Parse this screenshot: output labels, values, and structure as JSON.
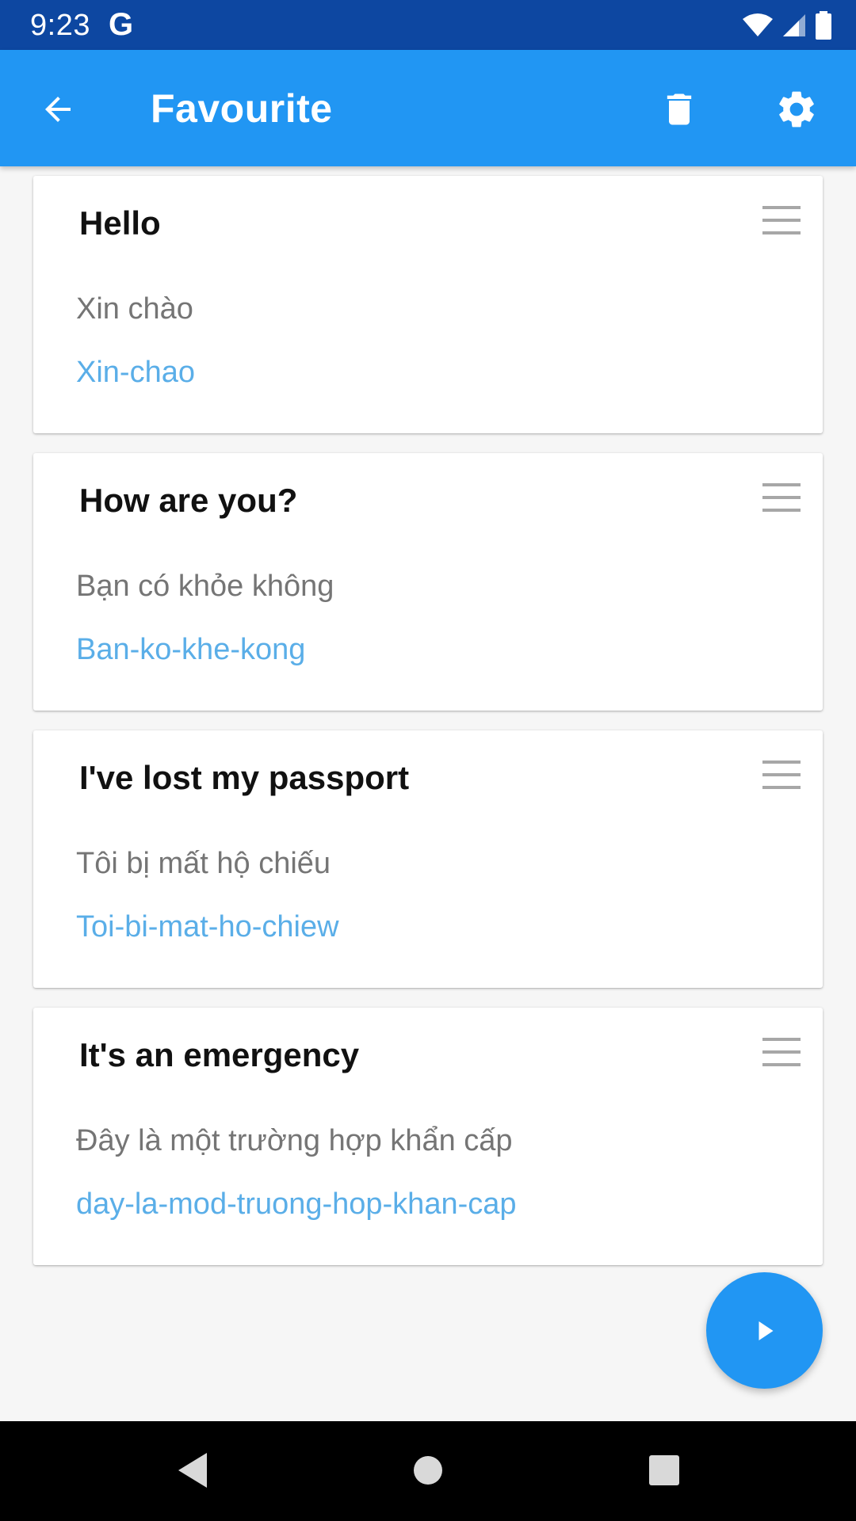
{
  "status_bar": {
    "time": "9:23",
    "notification_letter": "G"
  },
  "app_bar": {
    "title": "Favourite"
  },
  "cards": [
    {
      "title": "Hello",
      "translation": "Xin chào",
      "pronunciation": "Xin-chao"
    },
    {
      "title": "How are you?",
      "translation": "Bạn có khỏe không",
      "pronunciation": "Ban-ko-khe-kong"
    },
    {
      "title": "I've lost my passport",
      "translation": "Tôi bị mất hộ chiếu",
      "pronunciation": "Toi-bi-mat-ho-chiew"
    },
    {
      "title": "It's an emergency",
      "translation": "Đây là một trường hợp khẩn cấp",
      "pronunciation": "day-la-mod-truong-hop-khan-cap"
    }
  ],
  "icons": {
    "back": "arrow-left-icon",
    "delete": "trash-icon",
    "settings": "gear-icon",
    "play": "play-icon",
    "drag": "drag-handle-icon"
  },
  "colors": {
    "status_bar": "#0d47a1",
    "app_bar": "#2196f3",
    "fab": "#2196f3",
    "pronunciation": "#5aaee8",
    "translation": "#757575"
  }
}
